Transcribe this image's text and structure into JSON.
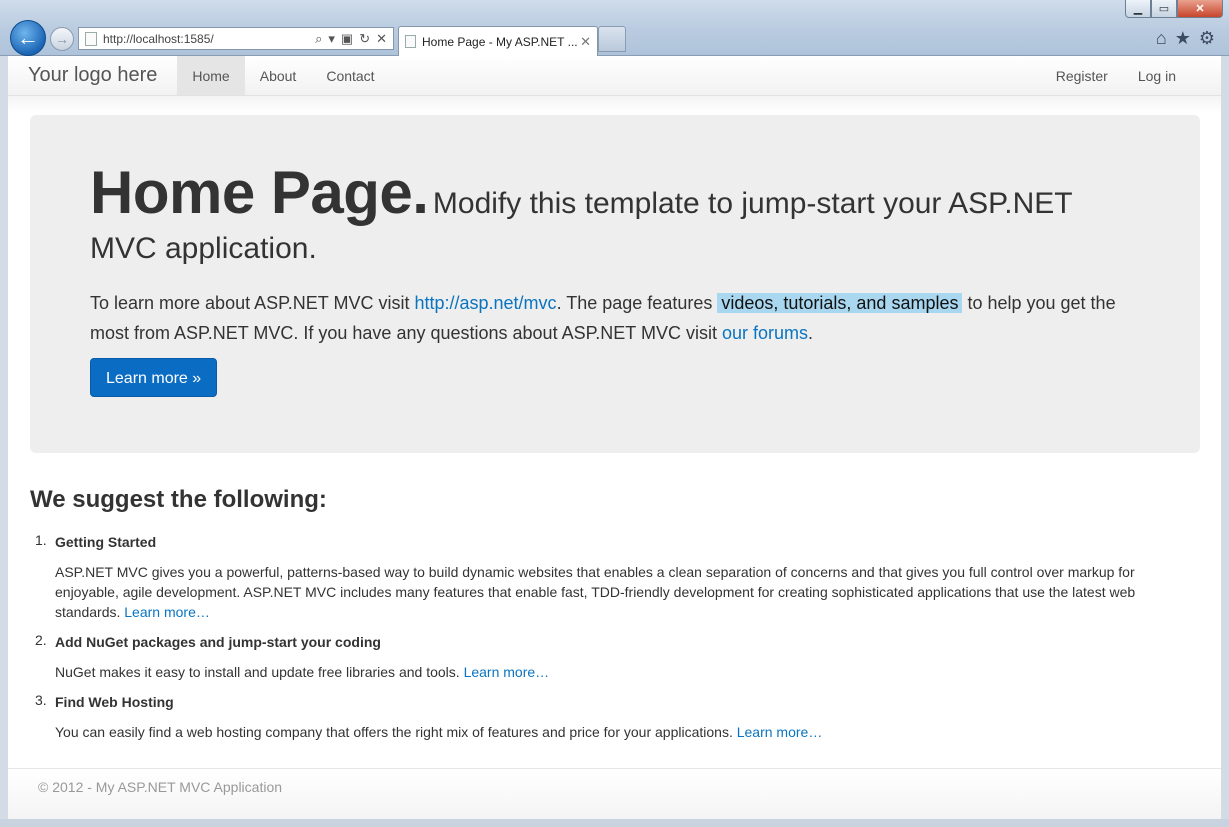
{
  "browser": {
    "url": "http://localhost:1585/",
    "tab_title": "Home Page - My ASP.NET ...",
    "tab_close": "✕",
    "back_glyph": "←",
    "forward_glyph": "→",
    "icons": {
      "search": "⌕",
      "dropdown": "▾",
      "compat": "▣",
      "refresh": "↻",
      "stop": "✕",
      "home": "⌂",
      "favorites": "★",
      "tools": "⚙"
    },
    "window_controls": {
      "minimize": "▁",
      "maximize": "▭",
      "close": "✕"
    }
  },
  "navbar": {
    "brand": "Your logo here",
    "items": [
      "Home",
      "About",
      "Contact"
    ],
    "active_index": 0,
    "right_items": [
      "Register",
      "Log in"
    ]
  },
  "hero": {
    "title": "Home Page.",
    "subtitle": "Modify this template to jump-start your ASP.NET MVC application.",
    "text_1": "To learn more about ASP.NET MVC visit ",
    "link_1": "http://asp.net/mvc",
    "text_2": ". The page features ",
    "highlight": "videos, tutorials, and samples",
    "text_3": " to help you get the most from ASP.NET MVC. If you have any questions about ASP.NET MVC visit ",
    "link_2": "our forums",
    "text_4": ".",
    "button_label": "Learn more »"
  },
  "suggest": {
    "heading": "We suggest the following:",
    "items": [
      {
        "num": "1.",
        "title": "Getting Started",
        "body": "ASP.NET MVC gives you a powerful, patterns-based way to build dynamic websites that enables a clean separation of concerns and that gives you full control over markup for enjoyable, agile development. ASP.NET MVC includes many features that enable fast, TDD-friendly development for creating sophisticated applications that use the latest web standards. ",
        "link": "Learn more…"
      },
      {
        "num": "2.",
        "title": "Add NuGet packages and jump-start your coding",
        "body": "NuGet makes it easy to install and update free libraries and tools. ",
        "link": "Learn more…"
      },
      {
        "num": "3.",
        "title": "Find Web Hosting",
        "body": "You can easily find a web hosting company that offers the right mix of features and price for your applications. ",
        "link": "Learn more…"
      }
    ]
  },
  "footer": {
    "text": "© 2012 - My ASP.NET MVC Application"
  },
  "colors": {
    "link": "#0a74c0",
    "button": "#0b6cc4",
    "highlight": "#a9d7ef",
    "hero_bg": "#eeeeee"
  }
}
